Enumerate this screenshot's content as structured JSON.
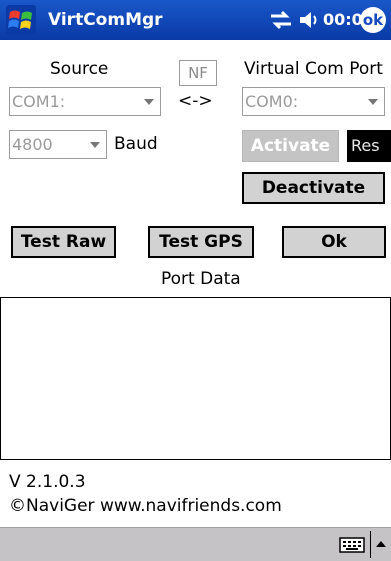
{
  "titlebar": {
    "app_title": "VirtComMgr",
    "clock": "00:08",
    "ok_label": "ok"
  },
  "labels": {
    "source": "Source",
    "nf": "NF",
    "virtual_com_port": "Virtual Com Port",
    "arrows": "<->",
    "baud": "Baud",
    "port_data": "Port Data",
    "version": "V 2.1.0.3",
    "copyright": "©NaviGer  www.navifriends.com"
  },
  "fields": {
    "source_value": "COM1:",
    "virtual_port_value": "COM0:",
    "baud_value": "4800"
  },
  "buttons": {
    "activate": "Activate",
    "reset": "Res",
    "deactivate": "Deactivate",
    "test_raw": "Test Raw",
    "test_gps": "Test GPS",
    "ok": "Ok"
  },
  "port_data_text": "",
  "colors": {
    "titlebar": "#0a3aa6",
    "button_face": "#d2d2d2",
    "menubar": "#c6c3c6"
  },
  "icons": [
    "windows-start-icon",
    "connectivity-icon",
    "volume-icon",
    "keyboard-icon",
    "sip-arrow-icon"
  ]
}
